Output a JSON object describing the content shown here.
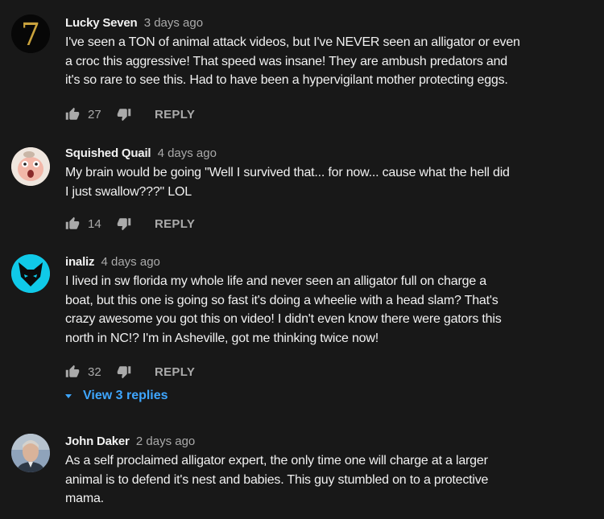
{
  "comments": [
    {
      "author": "Lucky Seven",
      "time": "3 days ago",
      "text": "I've seen a TON of animal attack videos, but I've NEVER seen an alligator or even\na croc this aggressive! That speed was insane! They are ambush predators and\nit's so rare to see this. Had to have been a hypervigilant mother protecting eggs.",
      "likes": "27",
      "reply_label": "REPLY",
      "avatar": "seven-logo-avatar"
    },
    {
      "author": "Squished Quail",
      "time": "4 days ago",
      "text": "My brain would be going \"Well I survived that... for now... cause what the hell did\nI just swallow???\"   LOL",
      "likes": "14",
      "reply_label": "REPLY",
      "avatar": "cartoon-face-avatar"
    },
    {
      "author": "inaliz",
      "time": "4 days ago",
      "text": "I lived in sw florida my whole life and never seen an alligator full on charge a\nboat, but this one is going so fast it's doing a wheelie with a head slam? That's\ncrazy awesome you got this on video! I didn't even know there were gators this\nnorth in NC!? I'm in Asheville, got me thinking twice now!",
      "likes": "32",
      "reply_label": "REPLY",
      "view_replies": "View 3 replies",
      "avatar": "fox-mask-avatar"
    },
    {
      "author": "John Daker",
      "time": "2 days ago",
      "text": "As a self proclaimed alligator expert, the only time one will charge at a larger\nanimal is to defend it's nest and babies.  This guy stumbled on to a protective\nmama.",
      "avatar": "man-photo-avatar"
    }
  ],
  "colors": {
    "background": "#181818",
    "text": "#f1f1f1",
    "secondary": "#aaaaaa",
    "link": "#3ea6ff"
  }
}
